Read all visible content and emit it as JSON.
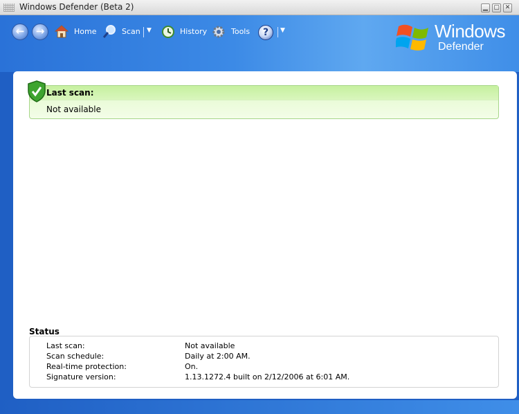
{
  "window": {
    "title": "Windows Defender (Beta 2)",
    "controls": {
      "minimize": "▁",
      "maximize": "▢",
      "close": "✕"
    }
  },
  "toolbar": {
    "back_icon": "back-arrow-icon",
    "forward_icon": "forward-arrow-icon",
    "home_label": "Home",
    "scan_label": "Scan",
    "history_label": "History",
    "tools_label": "Tools",
    "help_label": "?"
  },
  "logo": {
    "line1": "Windows",
    "line2": "Defender"
  },
  "alert": {
    "title": "Last scan:",
    "body": "Not available",
    "color": "#c6f09f"
  },
  "status": {
    "title": "Status",
    "rows": [
      {
        "label": "Last scan:",
        "value": "Not available"
      },
      {
        "label": "Scan schedule:",
        "value": "Daily at 2:00 AM."
      },
      {
        "label": "Real-time protection:",
        "value": "On."
      },
      {
        "label": "Signature version:",
        "value": "1.13.1272.4 built on 2/12/2006 at 6:01 AM."
      }
    ]
  },
  "colors": {
    "header_blue": "#2a72d8",
    "accent_green": "#a7d68a"
  }
}
